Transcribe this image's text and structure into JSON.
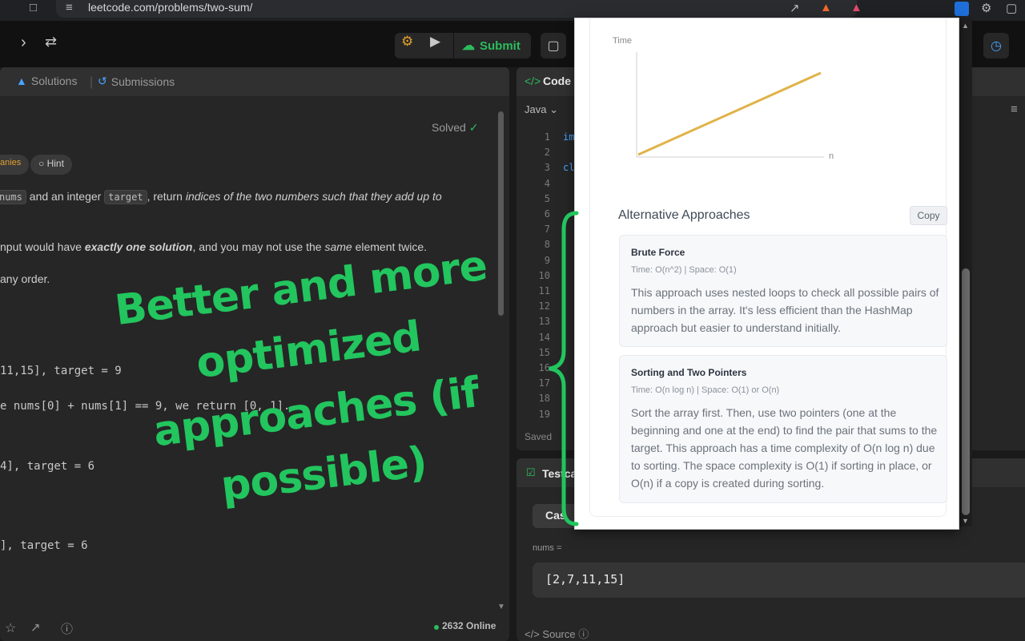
{
  "browser": {
    "url": "leetcode.com/problems/two-sum/"
  },
  "toolbar": {
    "submit_label": "Submit"
  },
  "left_panel": {
    "tabs": [
      {
        "label": "Solutions"
      },
      {
        "label": "Submissions"
      }
    ],
    "solved_label": "Solved",
    "topic_chip": "anies",
    "hint_label": "Hint",
    "desc_line1_code1": "nums",
    "desc_line1_mid": "and an integer",
    "desc_line1_code2": "target",
    "desc_line1_after": ", return",
    "desc_line1_italic": "indices of the two numbers such that they add up to",
    "desc_line2_pre": "nput would have",
    "desc_line2_bold": "exactly one solution",
    "desc_line2_post": ", and you may not use the",
    "desc_line2_italic": "same",
    "desc_line2_end": "element twice.",
    "desc_line3": "any order.",
    "example1_input": " 11,15], target = 9",
    "example1_expl": "e nums[0] + nums[1] == 9, we return [0, 1].",
    "example2_input": "4], target = 6",
    "example3_input": "], target = 6",
    "online_count": "2632 Online"
  },
  "code_panel": {
    "title": "Code",
    "language": "Java",
    "line_numbers": [
      "1",
      "2",
      "3",
      "4",
      "5",
      "6",
      "7",
      "8",
      "9",
      "10",
      "11",
      "12",
      "13",
      "14",
      "15",
      "16",
      "17",
      "18",
      "19"
    ],
    "line1_frag": "im",
    "line3_frag": "cl",
    "saved_label": "Saved"
  },
  "test_panel": {
    "title": "Testca",
    "case_tab": "Cas",
    "nums_label": "nums =",
    "nums_value": "[2,7,11,15]",
    "source_label": "Source"
  },
  "popup": {
    "chart_data": {
      "type": "line",
      "xlabel": "n",
      "ylabel": "Time",
      "series": [
        {
          "x": [
            0,
            1
          ],
          "y": [
            0,
            1
          ]
        }
      ],
      "color": "#e0b349"
    },
    "alt_title": "Alternative Approaches",
    "copy_label": "Copy",
    "approaches": [
      {
        "title": "Brute Force",
        "meta": "Time: O(n^2) | Space: O(1)",
        "body": "This approach uses nested loops to check all possible pairs of numbers in the array. It's less efficient than the HashMap approach but easier to understand initially."
      },
      {
        "title": "Sorting and Two Pointers",
        "meta": "Time: O(n log n) | Space: O(1) or O(n)",
        "body": "Sort the array first. Then, use two pointers (one at the beginning and one at the end) to find the pair that sums to the target. This approach has a time complexity of O(n log n) due to sorting. The space complexity is O(1) if sorting in place, or O(n) if a copy is created during sorting."
      }
    ]
  },
  "overlay": {
    "caption": "Better and more optimized approaches (if possible)"
  },
  "colors": {
    "accent_green": "#22c55e",
    "leetcode_green": "#2cbb5d",
    "chart_line": "#e0b349"
  }
}
